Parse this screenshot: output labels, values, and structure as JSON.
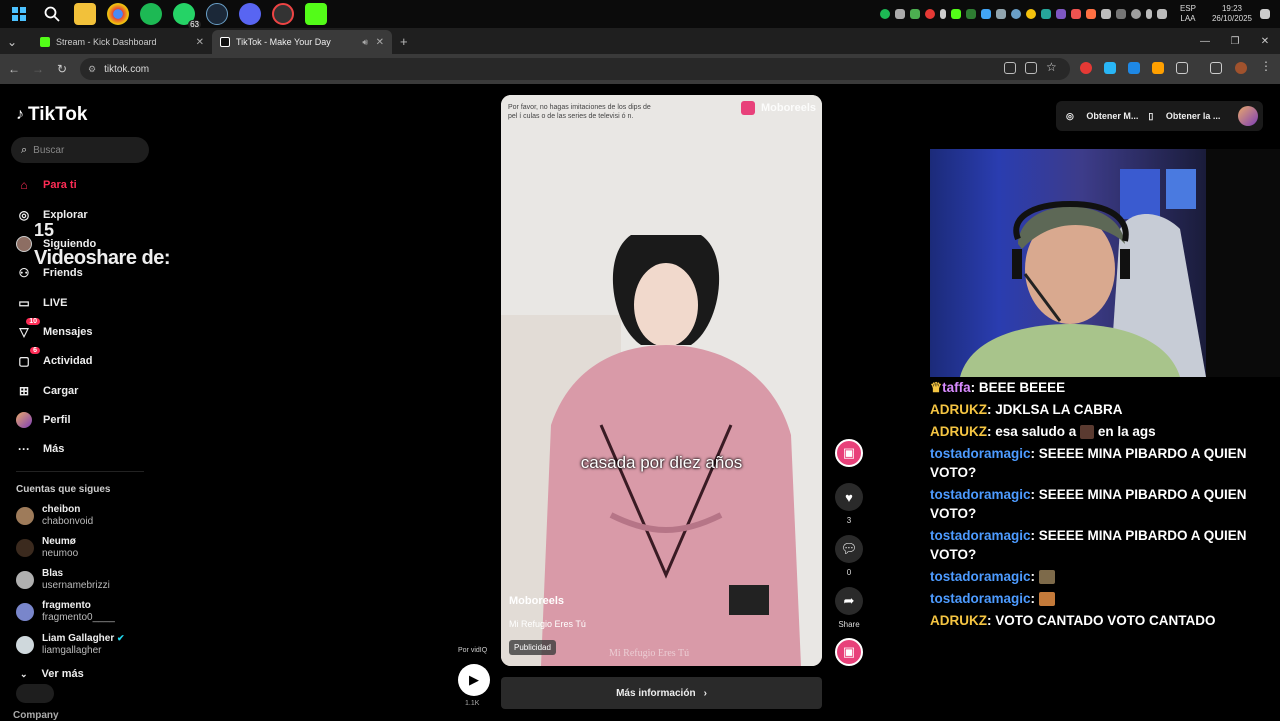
{
  "taskbar": {
    "icons": [
      "windows-icon",
      "search-icon",
      "file-explorer-icon",
      "chrome-icon",
      "spotify-icon",
      "whatsapp-icon",
      "steam-icon",
      "discord-icon",
      "browser-icon",
      "kick-icon"
    ],
    "whatsapp_count": "63",
    "language": "ESP",
    "layout": "LAA",
    "time": "19:23",
    "date": "26/10/2025"
  },
  "browser": {
    "tabs": [
      {
        "title": "Stream - Kick Dashboard",
        "color": "#53fc18"
      },
      {
        "title": "TikTok - Make Your Day",
        "color": "#ffffff"
      }
    ],
    "url": "tiktok.com"
  },
  "tiktok": {
    "logo": "TikTok",
    "search_placeholder": "Buscar",
    "nav": {
      "para_ti": "Para ti",
      "explorar": "Explorar",
      "siguiendo": "Siguiendo",
      "friends": "Friends",
      "live": "LIVE",
      "mensajes": "Mensajes",
      "mensajes_badge": "10",
      "actividad": "Actividad",
      "actividad_badge": "6",
      "cargar": "Cargar",
      "perfil": "Perfil",
      "mas": "Más"
    },
    "overlay": {
      "count": "15",
      "text": "Videoshare de:"
    },
    "following_title": "Cuentas que sigues",
    "following": [
      {
        "name": "cheibon",
        "user": "chabonvoid"
      },
      {
        "name": "Neumø",
        "user": "neumoo"
      },
      {
        "name": "Blas",
        "user": "usernamebrizzi"
      },
      {
        "name": "fragmento",
        "user": "fragmento0____"
      },
      {
        "name": "Liam Gallagher",
        "user": "liamgallagher"
      }
    ],
    "ver_mas": "Ver más",
    "company": "Company",
    "video": {
      "disclaimer": "Por favor, no hagas imitaciones de los dips de pel í culas o de las series de televisi ó n.",
      "brand": "Moboreels",
      "caption": "casada por diez años",
      "username": "Moboreels",
      "title": "Mi Refugio Eres Tú",
      "tag": "Publicidad",
      "watermark": "Mi Refugio Eres Tú"
    },
    "mas_info": "Más información",
    "por_vidiq": "Por vidIQ",
    "play_count": "1.1K",
    "actions": {
      "likes": "3",
      "comments": "0",
      "share": "Share"
    },
    "top_buttons": {
      "get_app": "Obtener M...",
      "get_desktop": "Obtener la ..."
    }
  },
  "chat": [
    {
      "user": "taffa",
      "color": "#d98cff",
      "crown": true,
      "text": "BEEE BEEEE"
    },
    {
      "user": "ADRUKZ",
      "color": "#f5c542",
      "text": "JDKLSA LA CABRA"
    },
    {
      "user": "ADRUKZ",
      "color": "#f5c542",
      "text": "esa saludo a",
      "text2": "en la ags"
    },
    {
      "user": "tostadoramagic",
      "color": "#4d9bff",
      "text": "SEEEE MINA PIBARDO A QUIEN VOTO?"
    },
    {
      "user": "tostadoramagic",
      "color": "#4d9bff",
      "text": "SEEEE MINA PIBARDO A QUIEN VOTO?"
    },
    {
      "user": "tostadoramagic",
      "color": "#4d9bff",
      "text": "SEEEE MINA PIBARDO A QUIEN VOTO?"
    },
    {
      "user": "tostadoramagic",
      "color": "#4d9bff",
      "text": ""
    },
    {
      "user": "tostadoramagic",
      "color": "#4d9bff",
      "text": ""
    },
    {
      "user": "ADRUKZ",
      "color": "#f5c542",
      "text": "VOTO CANTADO VOTO CANTADO"
    }
  ]
}
